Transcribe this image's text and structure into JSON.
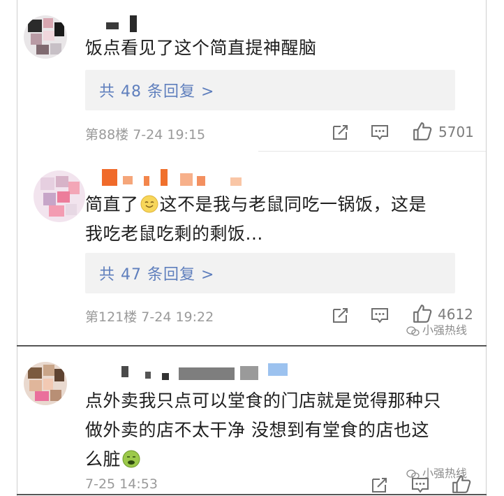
{
  "comments": [
    {
      "text": [
        "饭点看见了这个简直提神醒脑"
      ],
      "replies": "共 48 条回复 >",
      "meta": "第88楼 7-24 19:15",
      "likes": "5701"
    },
    {
      "text_before_emoji": "简直了",
      "text_after_emoji": "这不是我与老鼠同吃一锅饭，这是",
      "text_line2": "我吃老鼠吃剩的剩饭...",
      "emoji": "smiling-face-icon",
      "replies": "共 47 条回复 >",
      "meta": "第121楼 7-24 19:22",
      "likes": "4612"
    },
    {
      "text": [
        "点外卖我只点可以堂食的门店就是觉得那种只",
        "做外卖的店不太干净 没想到有堂食的店也这"
      ],
      "text_line3": "么脏",
      "emoji": "nauseated-face-icon",
      "meta": "7-25 14:53"
    }
  ],
  "watermark": "小强热线",
  "icons": {
    "share": "share-icon",
    "comment": "comment-icon",
    "like": "thumbs-up-icon"
  },
  "colors": {
    "reply_link": "#5f7fbd",
    "meta": "#9a9a9a",
    "reply_bg": "#f2f2f2"
  }
}
